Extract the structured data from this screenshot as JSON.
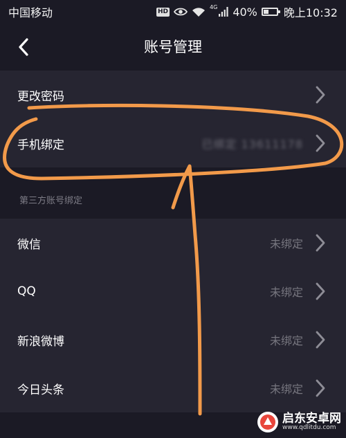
{
  "status_bar": {
    "carrier": "中国移动",
    "hd": "HD",
    "network": "4G",
    "battery": "40%",
    "battery_level": 0.4,
    "time": "晚上10:32"
  },
  "header": {
    "title": "账号管理"
  },
  "account_rows": [
    {
      "label": "更改密码",
      "value": ""
    },
    {
      "label": "手机绑定",
      "value": "已绑定 13611178"
    }
  ],
  "third_party": {
    "section_title": "第三方账号绑定",
    "rows": [
      {
        "label": "微信",
        "value": "未绑定"
      },
      {
        "label": "QQ",
        "value": "未绑定"
      },
      {
        "label": "新浪微博",
        "value": "未绑定"
      },
      {
        "label": "今日头条",
        "value": "未绑定"
      }
    ]
  },
  "watermark": {
    "name": "启东安卓网",
    "url": "www.qdlitdu.com"
  },
  "colors": {
    "background": "#1b1a25",
    "row_background": "#262531",
    "annotation_stroke": "#f29a4a"
  },
  "icons": {
    "back": "chevron-left-icon",
    "row_arrow": "chevron-right-icon"
  }
}
